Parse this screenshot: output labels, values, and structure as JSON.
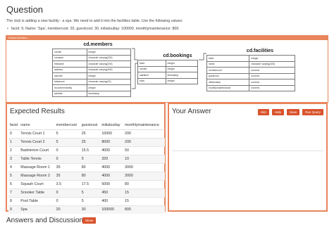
{
  "question": {
    "title": "Question",
    "text": "The club is adding a new facility - a spa. We need to add it into the facilities table. Use the following values:",
    "bullet": "facid: 9, Name: 'Spa', membercost: 20, guestcost: 30, initialoutlay: 100000, monthlymaintenance: 800."
  },
  "schema": {
    "bar_label": "Schema reminder ▸",
    "members": {
      "title": "cd.members",
      "rows": [
        [
          "memid",
          "integer"
        ],
        [
          "surname",
          "character varying(200)"
        ],
        [
          "firstname",
          "character varying(200)"
        ],
        [
          "address",
          "character varying(300)"
        ],
        [
          "zipcode",
          "integer"
        ],
        [
          "telephone",
          "character varying(20)"
        ],
        [
          "recommendedby",
          "integer"
        ],
        [
          "joindate",
          "timestamp"
        ]
      ]
    },
    "bookings": {
      "title": "cd.bookings",
      "rows": [
        [
          "facid",
          "integer"
        ],
        [
          "memid",
          "integer"
        ],
        [
          "starttime",
          "timestamp"
        ],
        [
          "slots",
          "integer"
        ]
      ]
    },
    "facilities": {
      "title": "cd.facilities",
      "rows": [
        [
          "facid",
          "integer"
        ],
        [
          "name",
          "character varying(100)"
        ],
        [
          "membercost",
          "numeric"
        ],
        [
          "guestcost",
          "numeric"
        ],
        [
          "initialoutlay",
          "numeric"
        ],
        [
          "monthlymaintenance",
          "numeric"
        ]
      ]
    }
  },
  "expected": {
    "title": "Expected Results",
    "columns": [
      "facid",
      "name",
      "membercost",
      "guestcost",
      "initialoutlay",
      "monthlymaintenance"
    ],
    "rows": [
      [
        "0",
        "Tennis Court 1",
        "5",
        "25",
        "10000",
        "200"
      ],
      [
        "1",
        "Tennis Court 2",
        "5",
        "25",
        "8000",
        "200"
      ],
      [
        "2",
        "Badminton Court",
        "0",
        "15.5",
        "4000",
        "50"
      ],
      [
        "3",
        "Table Tennis",
        "0",
        "5",
        "320",
        "10"
      ],
      [
        "4",
        "Massage Room 1",
        "35",
        "80",
        "4000",
        "3000"
      ],
      [
        "5",
        "Massage Room 2",
        "35",
        "80",
        "4000",
        "3000"
      ],
      [
        "6",
        "Squash Court",
        "3.5",
        "17.5",
        "5000",
        "80"
      ],
      [
        "7",
        "Snooker Table",
        "0",
        "5",
        "450",
        "15"
      ],
      [
        "8",
        "Pool Table",
        "0",
        "5",
        "400",
        "15"
      ],
      [
        "9",
        "Spa",
        "20",
        "30",
        "100000",
        "800"
      ]
    ]
  },
  "answer": {
    "title": "Your Answer",
    "buttons": [
      "Hint",
      "Help",
      "Save",
      "Run Query"
    ]
  },
  "discussion": {
    "title": "Answers and Discussion",
    "show_label": "Show"
  },
  "colors": {
    "accent": "#e8855a",
    "button": "#d9532c"
  }
}
